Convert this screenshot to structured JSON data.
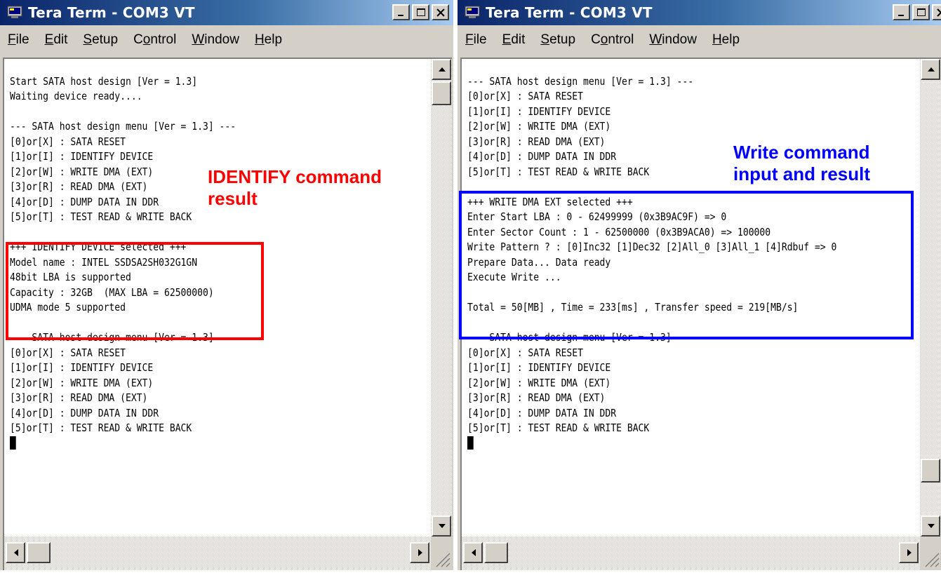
{
  "windows": [
    {
      "title": "Tera Term - COM3 VT",
      "menu": [
        {
          "label": "File",
          "accel": "F",
          "rest": "ile"
        },
        {
          "label": "Edit",
          "accel": "E",
          "rest": "dit"
        },
        {
          "label": "Setup",
          "accel": "S",
          "rest": "etup"
        },
        {
          "label": "Control",
          "pre": "C",
          "accel": "o",
          "rest": "ntrol"
        },
        {
          "label": "Window",
          "accel": "W",
          "rest": "indow"
        },
        {
          "label": "Help",
          "accel": "H",
          "rest": "elp"
        }
      ],
      "terminal_lines": [
        "",
        "Start SATA host design [Ver = 1.3]",
        "Waiting device ready....",
        "",
        "--- SATA host design menu [Ver = 1.3] ---",
        "[0]or[X] : SATA RESET",
        "[1]or[I] : IDENTIFY DEVICE",
        "[2]or[W] : WRITE DMA (EXT)",
        "[3]or[R] : READ DMA (EXT)",
        "[4]or[D] : DUMP DATA IN DDR",
        "[5]or[T] : TEST READ & WRITE BACK",
        "",
        "+++ IDENTIFY DEVICE selected +++",
        "Model name : INTEL SSDSA2SH032G1GN",
        "48bit LBA is supported",
        "Capacity : 32GB  (MAX LBA = 62500000)",
        "UDMA mode 5 supported",
        "",
        "--- SATA host design menu [Ver = 1.3] ---",
        "[0]or[X] : SATA RESET",
        "[1]or[I] : IDENTIFY DEVICE",
        "[2]or[W] : WRITE DMA (EXT)",
        "[3]or[R] : READ DMA (EXT)",
        "[4]or[D] : DUMP DATA IN DDR",
        "[5]or[T] : TEST READ & WRITE BACK"
      ],
      "annotation": "IDENTIFY command\nresult",
      "annotation_color": "#ff0000"
    },
    {
      "title": "Tera Term - COM3 VT",
      "menu": [
        {
          "label": "File",
          "accel": "F",
          "rest": "ile"
        },
        {
          "label": "Edit",
          "accel": "E",
          "rest": "dit"
        },
        {
          "label": "Setup",
          "accel": "S",
          "rest": "etup"
        },
        {
          "label": "Control",
          "pre": "C",
          "accel": "o",
          "rest": "ntrol"
        },
        {
          "label": "Window",
          "accel": "W",
          "rest": "indow"
        },
        {
          "label": "Help",
          "accel": "H",
          "rest": "elp"
        }
      ],
      "terminal_lines": [
        "",
        "--- SATA host design menu [Ver = 1.3] ---",
        "[0]or[X] : SATA RESET",
        "[1]or[I] : IDENTIFY DEVICE",
        "[2]or[W] : WRITE DMA (EXT)",
        "[3]or[R] : READ DMA (EXT)",
        "[4]or[D] : DUMP DATA IN DDR",
        "[5]or[T] : TEST READ & WRITE BACK",
        "",
        "+++ WRITE DMA EXT selected +++",
        "Enter Start LBA : 0 - 62499999 (0x3B9AC9F) => 0",
        "Enter Sector Count : 1 - 62500000 (0x3B9ACA0) => 100000",
        "Write Pattern ? : [0]Inc32 [1]Dec32 [2]All_0 [3]All_1 [4]Rdbuf => 0",
        "Prepare Data... Data ready",
        "Execute Write ...",
        "",
        "Total = 50[MB] , Time = 233[ms] , Transfer speed = 219[MB/s]",
        "",
        "--- SATA host design menu [Ver = 1.3] ---",
        "[0]or[X] : SATA RESET",
        "[1]or[I] : IDENTIFY DEVICE",
        "[2]or[W] : WRITE DMA (EXT)",
        "[3]or[R] : READ DMA (EXT)",
        "[4]or[D] : DUMP DATA IN DDR",
        "[5]or[T] : TEST READ & WRITE BACK"
      ],
      "annotation": "Write command\ninput and result",
      "annotation_color": "#0000ff"
    }
  ]
}
